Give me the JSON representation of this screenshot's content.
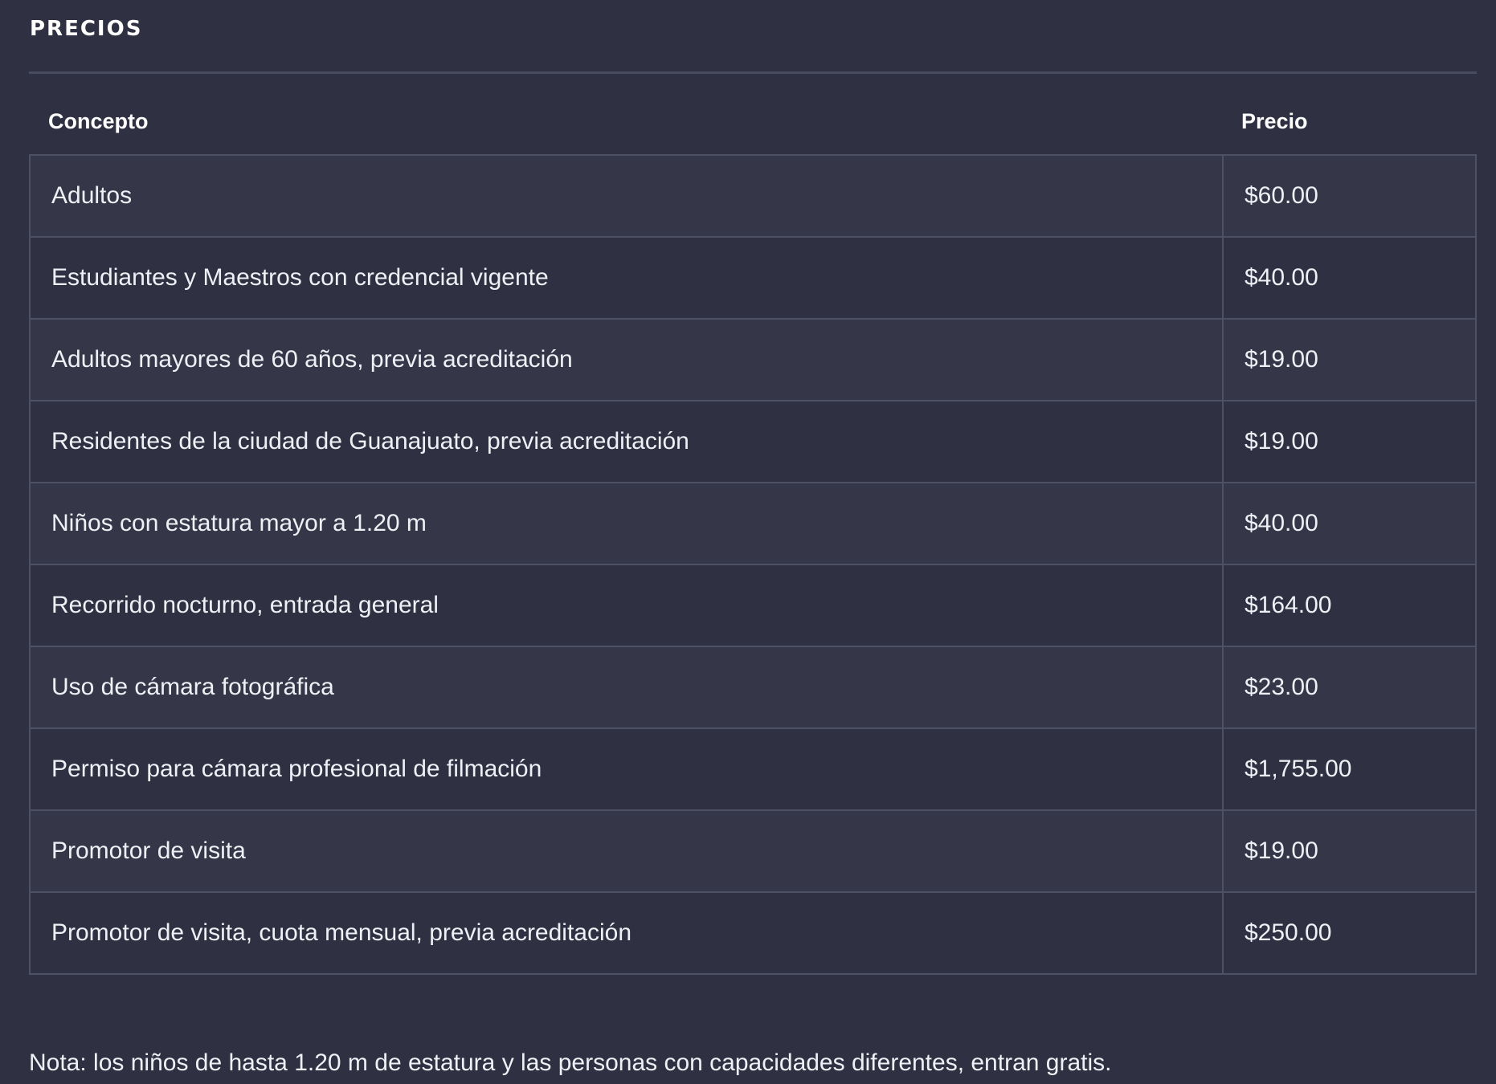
{
  "section": {
    "title": "PRECIOS"
  },
  "table": {
    "headers": {
      "concept": "Concepto",
      "price": "Precio"
    },
    "rows": [
      {
        "concept": "Adultos",
        "price": "$60.00"
      },
      {
        "concept": "Estudiantes y Maestros con credencial vigente",
        "price": "$40.00"
      },
      {
        "concept": "Adultos mayores de 60 años, previa acreditación",
        "price": "$19.00"
      },
      {
        "concept": "Residentes de la ciudad de Guanajuato, previa acreditación",
        "price": "$19.00"
      },
      {
        "concept": "Niños con estatura mayor a 1.20 m",
        "price": "$40.00"
      },
      {
        "concept": "Recorrido nocturno, entrada general",
        "price": "$164.00"
      },
      {
        "concept": "Uso de cámara fotográfica",
        "price": "$23.00"
      },
      {
        "concept": "Permiso para cámara profesional de filmación",
        "price": "$1,755.00"
      },
      {
        "concept": "Promotor de visita",
        "price": "$19.00"
      },
      {
        "concept": "Promotor de visita, cuota mensual, previa acreditación",
        "price": "$250.00"
      }
    ]
  },
  "note": "Nota: los niños de hasta 1.20 m de estatura y las personas con capacidades diferentes, entran gratis.",
  "colors": {
    "background": "#2f3142",
    "row_alt": "#353748",
    "border": "#4e5163",
    "text": "#ffffff"
  }
}
